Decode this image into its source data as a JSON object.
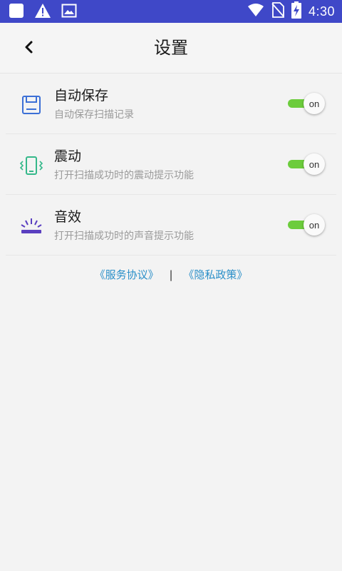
{
  "status_bar": {
    "time": "4:30"
  },
  "header": {
    "title": "设置"
  },
  "settings": [
    {
      "title": "自动保存",
      "description": "自动保存扫描记录",
      "toggle_label": "on",
      "enabled": true
    },
    {
      "title": "震动",
      "description": "打开扫描成功时的震动提示功能",
      "toggle_label": "on",
      "enabled": true
    },
    {
      "title": "音效",
      "description": "打开扫描成功时的声音提示功能",
      "toggle_label": "on",
      "enabled": true
    }
  ],
  "footer": {
    "service_agreement": "《服务协议》",
    "separator": "|",
    "privacy_policy": "《隐私政策》"
  },
  "colors": {
    "status_bar": "#3f48c8",
    "toggle_on": "#6ccc3c",
    "link": "#2a8fc8",
    "save_icon": "#3b6fd6",
    "vibrate_icon": "#35b88a",
    "sound_icon": "#5a3fc0"
  },
  "icons": [
    "notification-square-icon",
    "warning-icon",
    "image-icon",
    "wifi-icon",
    "no-sim-icon",
    "battery-charging-icon",
    "back-arrow-icon",
    "save-icon",
    "vibrate-phone-icon",
    "sound-effect-icon"
  ]
}
